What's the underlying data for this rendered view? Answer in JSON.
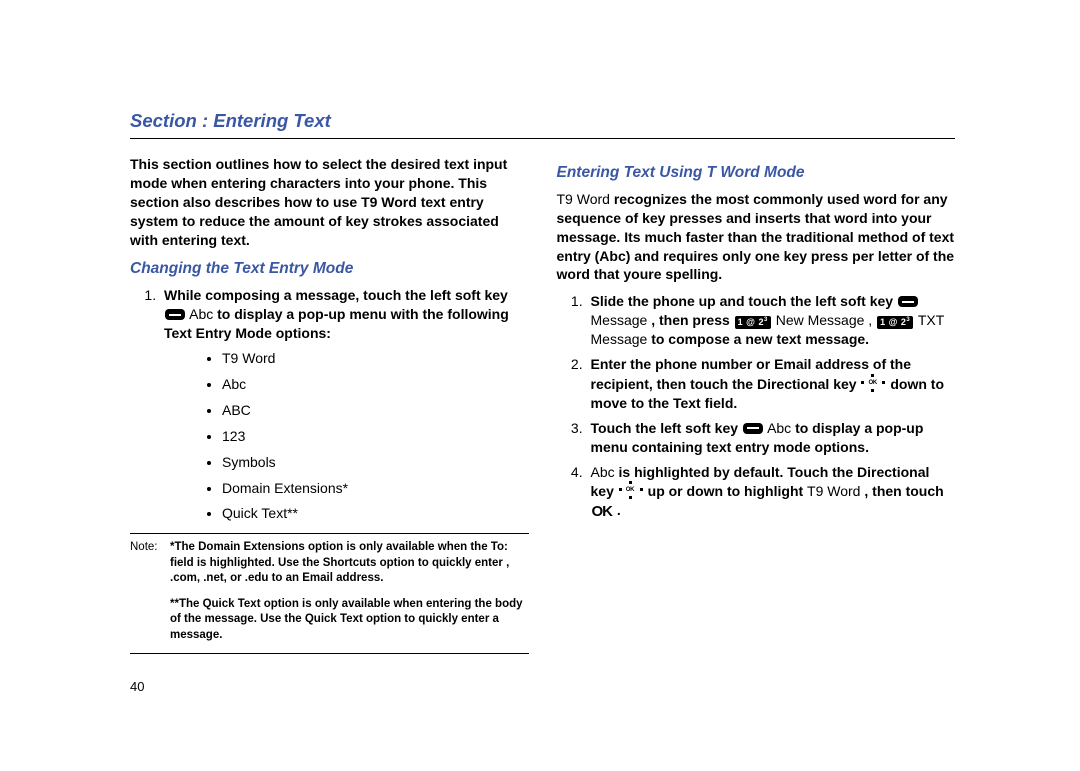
{
  "section_title": "Section : Entering Text",
  "left": {
    "intro": "This section outlines how to select the desired text input mode when entering characters into your phone. This section also describes how to use T9 Word text entry system to reduce the amount of key strokes associated with entering text.",
    "subhead": "Changing the Text Entry Mode",
    "step1_a": "While composing a message, touch the left soft key",
    "step1_b": "Abc",
    "step1_c": " to display a pop-up menu with the following Text Entry Mode options:",
    "modes": [
      "T9 Word",
      "Abc",
      "ABC",
      "123",
      "Symbols",
      "Domain Extensions*",
      "Quick Text**"
    ],
    "note_label": "Note:",
    "note1": "*The Domain Extensions option is only available when the To: field is highlighted. Use the Shortcuts option to quickly enter , .com, .net, or .edu to an Email address.",
    "note2": "**The Quick Text option is only available when entering the body of the message. Use the Quick Text option to quickly enter a message."
  },
  "right": {
    "subhead": "Entering Text Using T Word Mode",
    "intro_a": "T9 Word",
    "intro_b": " recognizes the most commonly used word for any sequence of key presses and inserts that word into your message. Its much faster than the traditional method of text entry (Abc) and requires only one key press per letter of the word that youre spelling.",
    "s1_a": "Slide the phone up and touch the left soft key",
    "s1_msg": "Message",
    "s1_b": " , then press ",
    "s1_new": " New Message ,  ",
    "s1_txt": " TXT Message",
    "s1_c": "  to compose a new text message.",
    "s2": "Enter the phone number or Email address of the recipient, then touch the Directional key ",
    "s2_b": " down to move to the Text field.",
    "s3_a": "Touch the left soft key",
    "s3_abc": " Abc",
    "s3_b": " to display a pop-up menu containing text entry mode options.",
    "s4_a": "Abc",
    "s4_b": " is highlighted by default. Touch the Directional key",
    "s4_c": " up or down to highlight ",
    "s4_d": "T9 Word",
    "s4_e": " , then touch ",
    "s4_f": " ."
  },
  "page_number": "40"
}
